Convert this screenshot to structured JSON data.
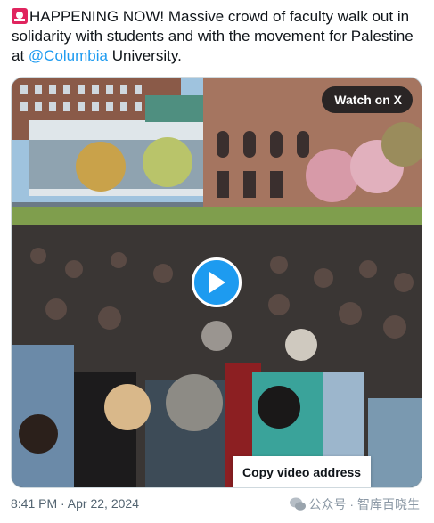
{
  "tweet": {
    "text_main": "HAPPENING NOW! Massive crowd of faculty walk out in solidarity with students and with the movement for Palestine at ",
    "mention": "@Columbia",
    "text_end": " University.",
    "siren_icon": "police-car-light-icon"
  },
  "media": {
    "watch_label": "Watch on X",
    "play_icon": "play-icon",
    "context_menu": {
      "copy_label": "Copy video address"
    }
  },
  "footer": {
    "timestamp": "8:41 PM · Apr 22, 2024"
  },
  "watermark": {
    "text": "公众号 · 智库百晓生",
    "icon": "wechat-icon"
  },
  "colors": {
    "accent": "#1d9bf0",
    "text": "#0f1419",
    "muted": "#536471"
  }
}
